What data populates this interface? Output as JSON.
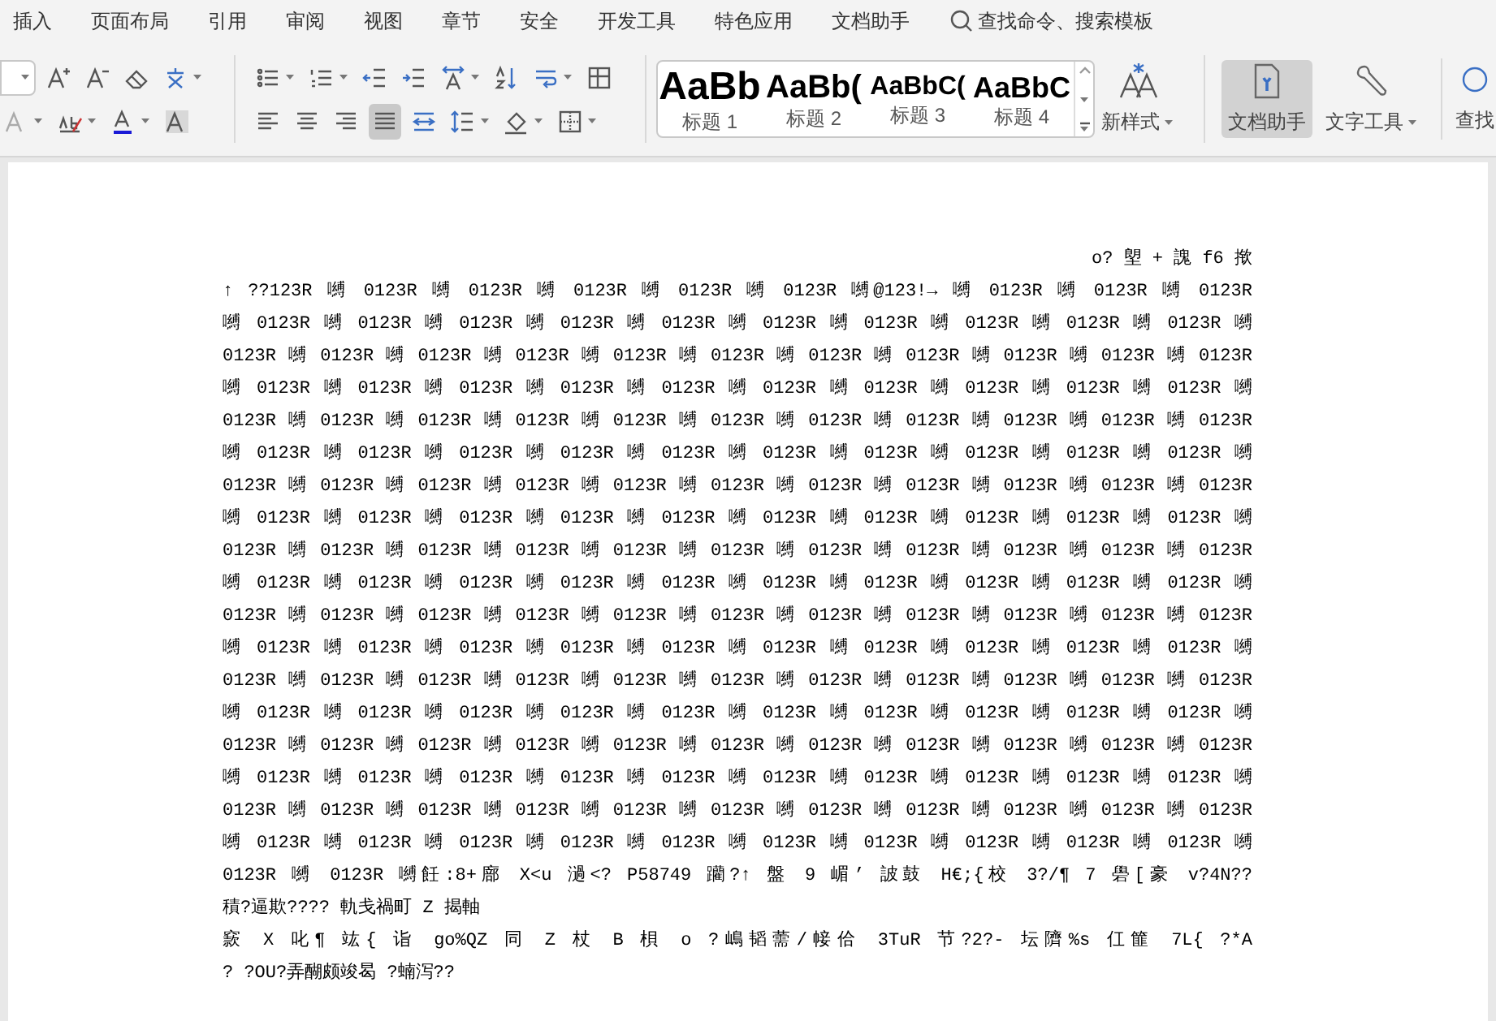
{
  "menu_tabs": [
    "插入",
    "页面布局",
    "引用",
    "审阅",
    "视图",
    "章节",
    "安全",
    "开发工具",
    "特色应用",
    "文档助手"
  ],
  "search": {
    "label": "查找命令、搜索模板"
  },
  "ribbon": {
    "align_buttons": [
      {
        "selected": false
      },
      {
        "selected": false
      },
      {
        "selected": false
      },
      {
        "selected": true
      },
      {
        "selected": false
      }
    ],
    "styles": [
      {
        "sample": "AaBb",
        "label": "标题 1"
      },
      {
        "sample": "AaBb(",
        "label": "标题 2"
      },
      {
        "sample": "AaBbC(",
        "label": "标题 3"
      },
      {
        "sample": "AaBbC",
        "label": "标题 4"
      }
    ],
    "new_style": {
      "label": "新样式"
    },
    "tools": [
      {
        "label": "文档助手",
        "selected": true
      },
      {
        "label": "文字工具",
        "selected": false
      }
    ],
    "find": {
      "label": "查找"
    }
  },
  "document": {
    "header_line": "o? 塱 + 謉 f6 揿",
    "paragraphs": [
      {
        "lines": [
          "↑ ??123R 嚩 0123R 嚩 0123R 嚩 0123R 嚩 0123R 嚩 0123R 嚩@123!→ 嚩 0123R 嚩 0123R 嚩 0123R",
          "嚩 0123R 嚩 0123R 嚩 0123R 嚩 0123R 嚩 0123R 嚩 0123R 嚩 0123R 嚩 0123R 嚩 0123R 嚩 0123R 嚩",
          "0123R 嚩 0123R 嚩 0123R 嚩 0123R 嚩 0123R 嚩 0123R 嚩 0123R 嚩 0123R 嚩 0123R 嚩 0123R 嚩 0123R",
          "嚩 0123R 嚩 0123R 嚩 0123R 嚩 0123R 嚩 0123R 嚩 0123R 嚩 0123R 嚩 0123R 嚩 0123R 嚩 0123R 嚩",
          "0123R 嚩 0123R 嚩 0123R 嚩 0123R 嚩 0123R 嚩 0123R 嚩 0123R 嚩 0123R 嚩 0123R 嚩 0123R 嚩 0123R",
          "嚩 0123R 嚩 0123R 嚩 0123R 嚩 0123R 嚩 0123R 嚩 0123R 嚩 0123R 嚩 0123R 嚩 0123R 嚩 0123R 嚩",
          "0123R 嚩 0123R 嚩 0123R 嚩 0123R 嚩 0123R 嚩 0123R 嚩 0123R 嚩 0123R 嚩 0123R 嚩 0123R 嚩 0123R",
          "嚩 0123R 嚩 0123R 嚩 0123R 嚩 0123R 嚩 0123R 嚩 0123R 嚩 0123R 嚩 0123R 嚩 0123R 嚩 0123R 嚩",
          "0123R 嚩 0123R 嚩 0123R 嚩 0123R 嚩 0123R 嚩 0123R 嚩 0123R 嚩 0123R 嚩 0123R 嚩 0123R 嚩 0123R",
          "嚩 0123R 嚩 0123R 嚩 0123R 嚩 0123R 嚩 0123R 嚩 0123R 嚩 0123R 嚩 0123R 嚩 0123R 嚩 0123R 嚩",
          "0123R 嚩 0123R 嚩 0123R 嚩 0123R 嚩 0123R 嚩 0123R 嚩 0123R 嚩 0123R 嚩 0123R 嚩 0123R 嚩 0123R",
          "嚩 0123R 嚩 0123R 嚩 0123R 嚩 0123R 嚩 0123R 嚩 0123R 嚩 0123R 嚩 0123R 嚩 0123R 嚩 0123R 嚩",
          "0123R 嚩 0123R 嚩 0123R 嚩 0123R 嚩 0123R 嚩 0123R 嚩 0123R 嚩 0123R 嚩 0123R 嚩 0123R 嚩 0123R",
          "嚩 0123R 嚩 0123R 嚩 0123R 嚩 0123R 嚩 0123R 嚩 0123R 嚩 0123R 嚩 0123R 嚩 0123R 嚩 0123R 嚩",
          "0123R 嚩 0123R 嚩 0123R 嚩 0123R 嚩 0123R 嚩 0123R 嚩 0123R 嚩 0123R 嚩 0123R 嚩 0123R 嚩 0123R",
          "嚩 0123R 嚩 0123R 嚩 0123R 嚩 0123R 嚩 0123R 嚩 0123R 嚩 0123R 嚩 0123R 嚩 0123R 嚩 0123R 嚩",
          "0123R 嚩 0123R 嚩 0123R 嚩 0123R 嚩 0123R 嚩 0123R 嚩 0123R 嚩 0123R 嚩 0123R 嚩 0123R 嚩 0123R",
          "嚩 0123R 嚩 0123R 嚩 0123R 嚩 0123R 嚩 0123R 嚩 0123R 嚩 0123R 嚩 0123R 嚩 0123R 嚩 0123R 嚩",
          "0123R 嚩 0123R 嚩飪:8+廍 X<u 濄<? P58749 躪?↑ 盤 9 嵋’ 詖鼓 H€;{校 3?/¶ 7 礐[豪 v?4N??",
          "積?逼欺???? 軌戋禍町 Z 揭軸"
        ]
      },
      {
        "lines": [
          "窾 X 叱¶ 竑{ 诣 go%QZ 同 Z 杖 B 梖 o ?嶋韬薷/帹佮 3TuR 节?2?- 坛隮%s 仜篚 7L{ ?*A",
          "? ?OU?弄醐颇竣曷 ?蝻泻??"
        ]
      }
    ]
  }
}
